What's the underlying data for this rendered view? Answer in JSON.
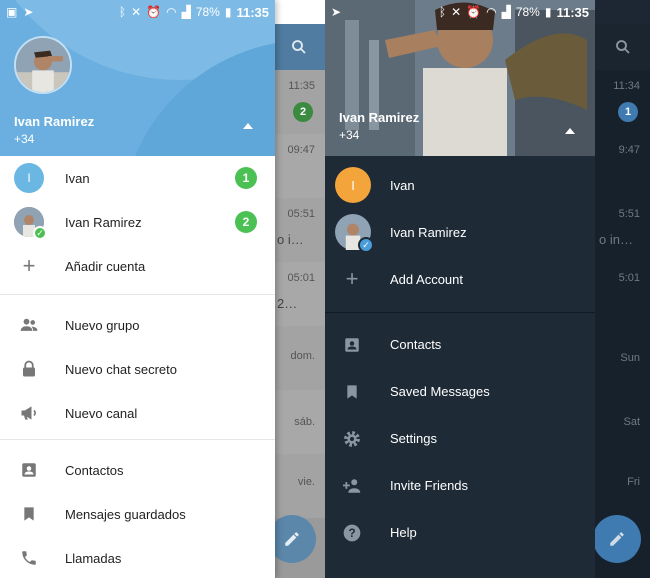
{
  "colors": {
    "accent_light": "#6aafe0",
    "counter_green": "#4cc153",
    "dark_bg": "#1c2733",
    "dark_drawer": "#1e2a36",
    "online_check_light": "#4cc153",
    "online_check_dark": "#4a9cdb",
    "avatar_ivan_light": "#6ab7e4",
    "avatar_ivan_dark": "#f3a43b"
  },
  "left": {
    "status": {
      "battery": "78%",
      "time": "11:35"
    },
    "header": {
      "name": "Ivan Ramirez",
      "phone": "+34"
    },
    "accounts": [
      {
        "initial": "I",
        "name": "Ivan",
        "count": "1"
      },
      {
        "name": "Ivan Ramirez",
        "count": "2"
      }
    ],
    "add_account": "Añadir cuenta",
    "menu_group1": [
      {
        "icon": "group-icon",
        "label": "Nuevo grupo"
      },
      {
        "icon": "lock-icon",
        "label": "Nuevo chat secreto"
      },
      {
        "icon": "megaphone-icon",
        "label": "Nuevo canal"
      }
    ],
    "menu_group2": [
      {
        "icon": "contacts-icon",
        "label": "Contactos"
      },
      {
        "icon": "bookmark-icon",
        "label": "Mensajes guardados"
      },
      {
        "icon": "phone-icon",
        "label": "Llamadas"
      }
    ],
    "background": {
      "times": [
        "11:35",
        "09:47",
        "05:51",
        "05:01",
        "dom.",
        "sáb.",
        "vie."
      ],
      "snippets": [
        "o i…",
        "2…"
      ],
      "counter": "2"
    }
  },
  "right": {
    "status": {
      "battery": "78%",
      "time": "11:35"
    },
    "header": {
      "name": "Ivan Ramirez",
      "phone": "+34"
    },
    "accounts": [
      {
        "initial": "I",
        "name": "Ivan"
      },
      {
        "name": "Ivan Ramirez"
      }
    ],
    "add_account": "Add Account",
    "menu": [
      {
        "icon": "contacts-icon",
        "label": "Contacts"
      },
      {
        "icon": "bookmark-icon",
        "label": "Saved Messages"
      },
      {
        "icon": "gear-icon",
        "label": "Settings"
      },
      {
        "icon": "add-person-icon",
        "label": "Invite Friends"
      },
      {
        "icon": "help-icon",
        "label": "Help"
      }
    ],
    "background": {
      "times": [
        "11:34",
        "9:47",
        "5:51",
        "5:01",
        "Sun",
        "Sat",
        "Fri"
      ],
      "snippets": [
        "o in…"
      ],
      "counter": "1"
    }
  }
}
